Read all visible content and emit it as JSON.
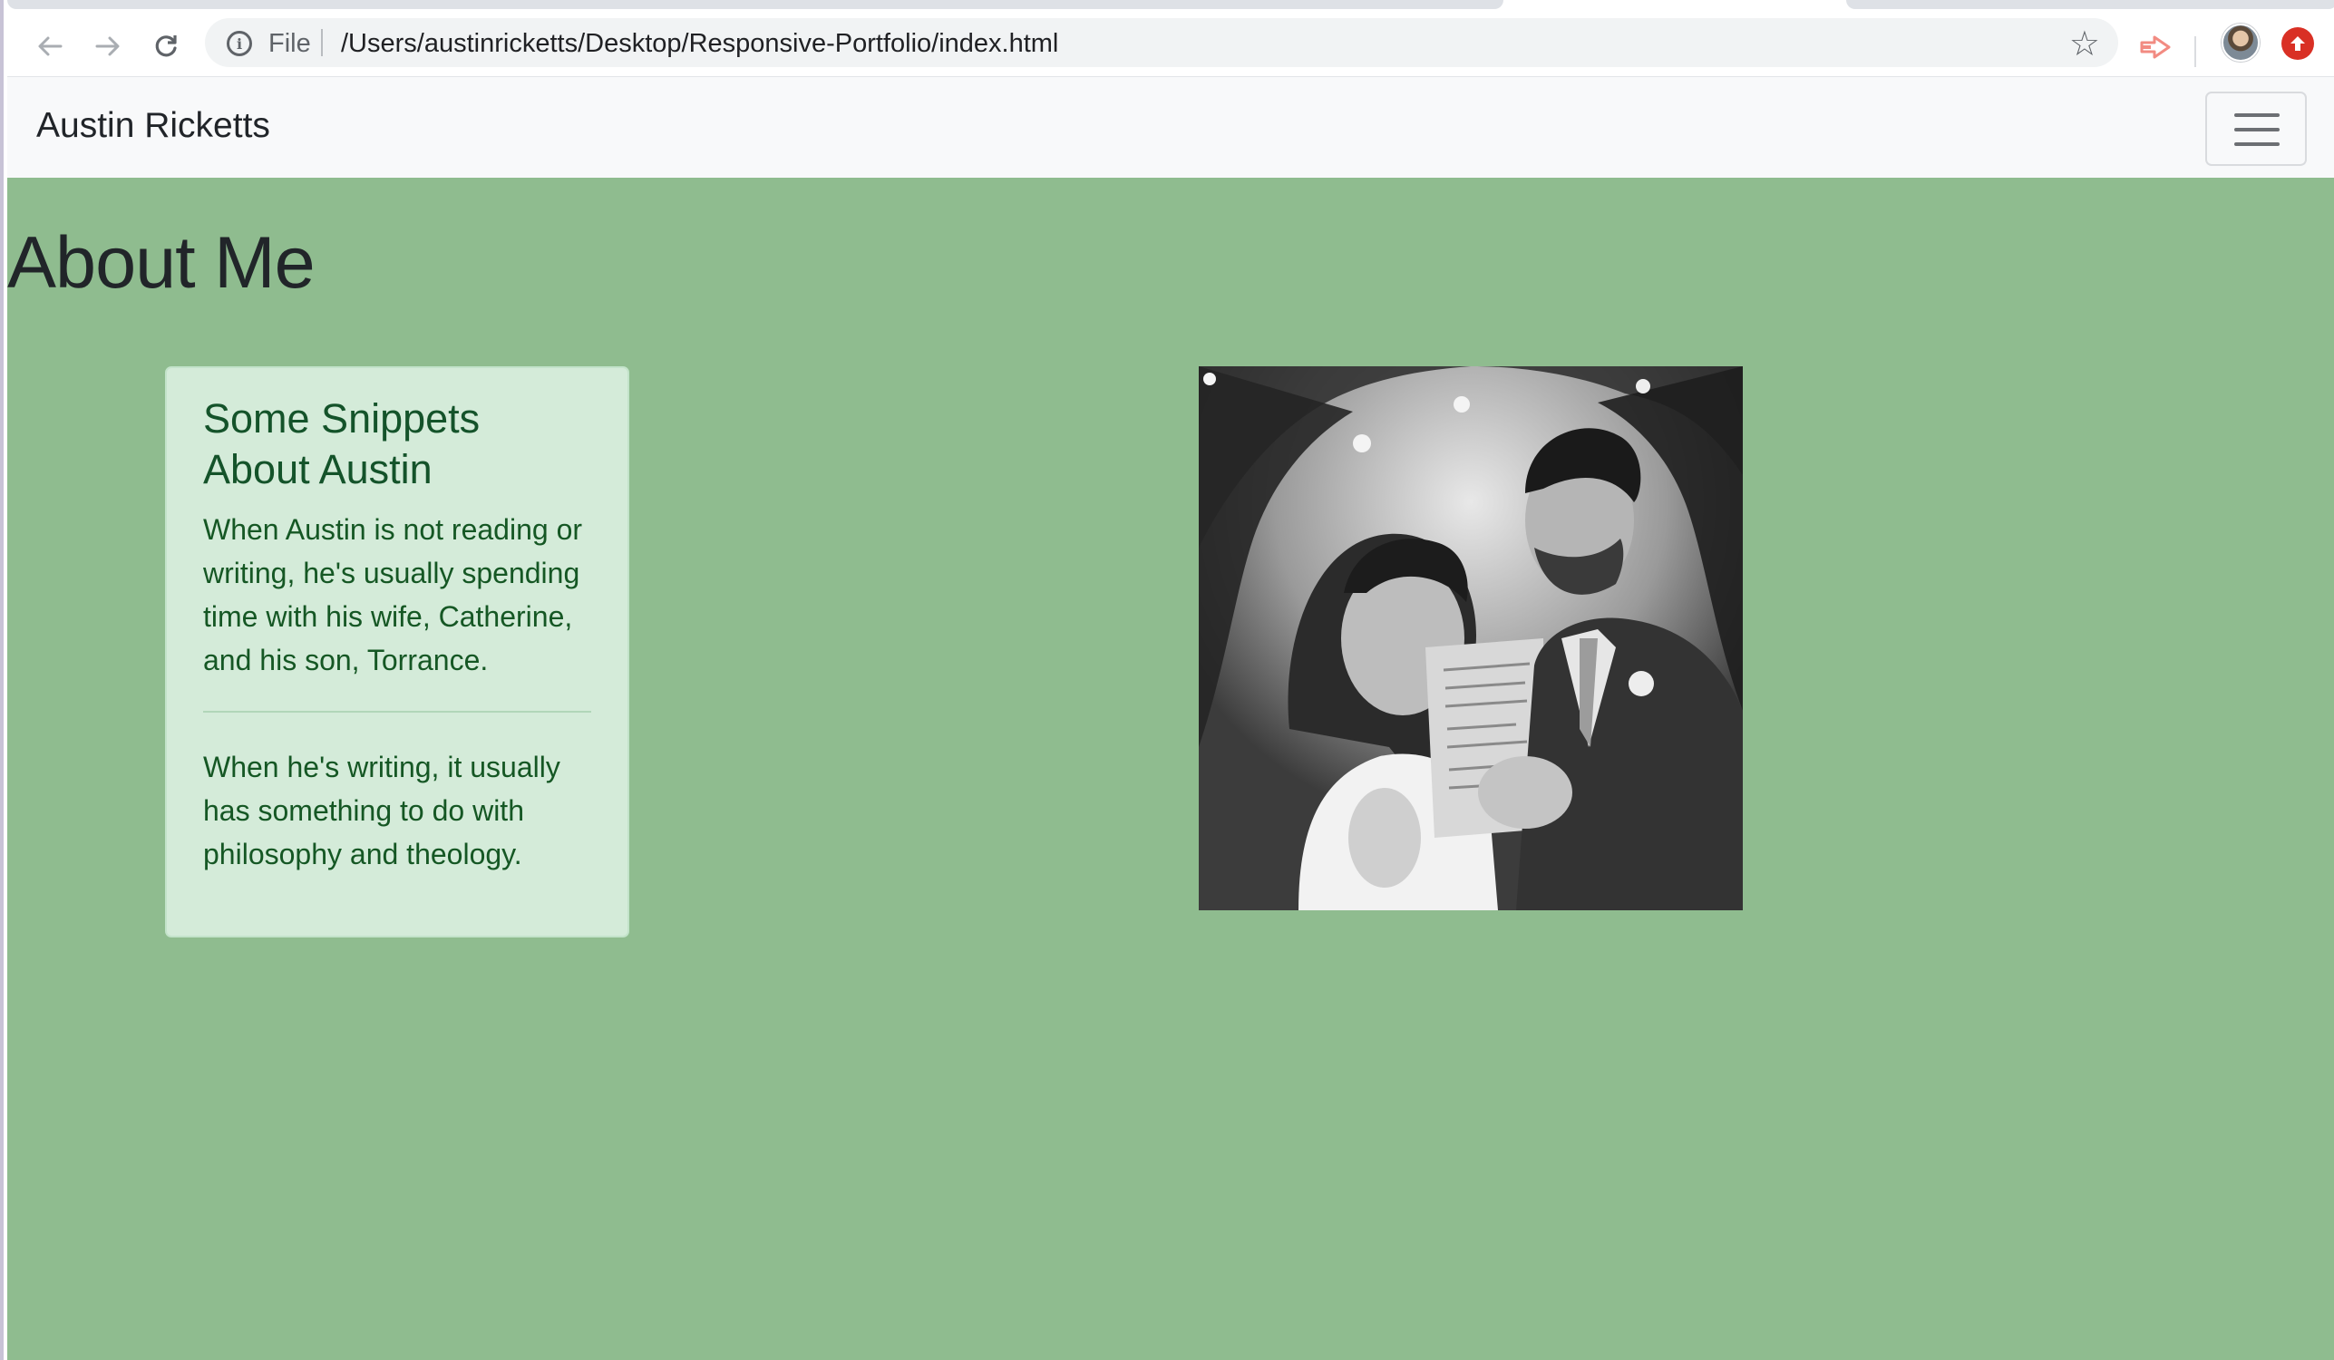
{
  "browser": {
    "scheme_label": "File",
    "url": "/Users/austinricketts/Desktop/Responsive-Portfolio/index.html",
    "icons": {
      "back": "arrow-left-icon",
      "forward": "arrow-right-icon",
      "reload": "reload-icon",
      "info": "info-icon",
      "bookmark": "star-icon",
      "extension": "extension-arrow-icon",
      "profile": "avatar",
      "update": "update-arrow-icon"
    }
  },
  "navbar": {
    "brand": "Austin Ricketts",
    "toggler_icon": "hamburger-icon"
  },
  "main": {
    "title": "About Me",
    "card": {
      "title": "Some Snippets About Austin",
      "paragraph_1": "When Austin is not reading or writing, he's usually spending time with his wife, Catherine, and his son, Torrance.",
      "paragraph_2": "When he's writing, it usually has something to do with philosophy and theology."
    },
    "photo_alt": "Austin and Catherine"
  },
  "colors": {
    "page_background": "#8fbc8f",
    "card_background": "#d4ebd9",
    "card_text": "#155724",
    "navbar_background": "#f8f9fa"
  }
}
